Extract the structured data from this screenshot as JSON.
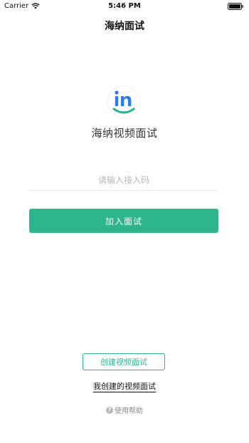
{
  "status_bar": {
    "carrier": "Carrier",
    "time": "5:46 PM",
    "wifi_icon": "wifi-icon",
    "battery_icon": "battery-icon"
  },
  "nav": {
    "title": "海纳面试"
  },
  "logo": {
    "icon": "in-logo-icon",
    "text": "in",
    "color": "#2b7de9",
    "smile_color": "#2fb58d"
  },
  "app_name": "海纳视频面试",
  "code_input": {
    "placeholder": "请输入接入码",
    "value": ""
  },
  "join_button": {
    "label": "加入面试",
    "color": "#2fb58d"
  },
  "create_button": {
    "label": "创建视频面试"
  },
  "my_created_link": {
    "label": "我创建的视频面试"
  },
  "help": {
    "icon": "question-circle-icon",
    "label": "使用帮助"
  }
}
